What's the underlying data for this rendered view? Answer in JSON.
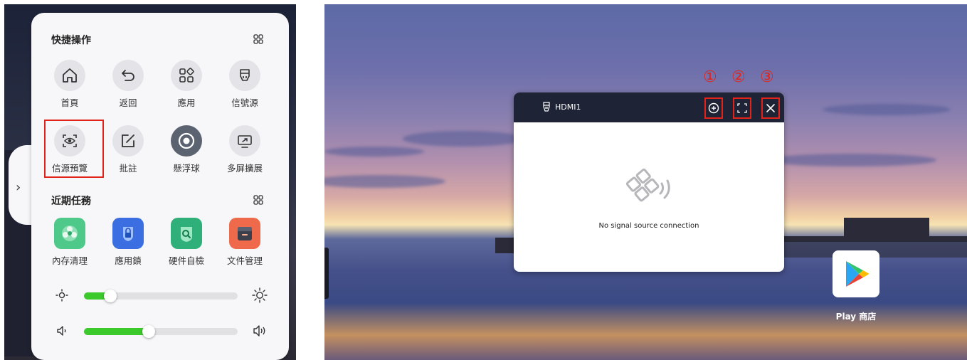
{
  "left_panel": {
    "quick_actions": {
      "title": "快捷操作",
      "items": [
        {
          "label": "首頁",
          "icon": "home-icon"
        },
        {
          "label": "返回",
          "icon": "back-icon"
        },
        {
          "label": "應用",
          "icon": "apps-icon"
        },
        {
          "label": "信號源",
          "icon": "signal-source-icon"
        },
        {
          "label": "信源預覽",
          "icon": "source-preview-icon"
        },
        {
          "label": "批註",
          "icon": "annotate-icon"
        },
        {
          "label": "懸浮球",
          "icon": "floating-ball-icon"
        },
        {
          "label": "多屏擴展",
          "icon": "multi-screen-icon"
        }
      ]
    },
    "recent_tasks": {
      "title": "近期任務",
      "items": [
        {
          "label": "內存清理",
          "icon": "memory-clean-icon",
          "color": "#4fc98a"
        },
        {
          "label": "應用鎖",
          "icon": "app-lock-icon",
          "color": "#3b6ee0"
        },
        {
          "label": "硬件自檢",
          "icon": "hardware-check-icon",
          "color": "#2fb07a"
        },
        {
          "label": "文件管理",
          "icon": "file-manager-icon",
          "color": "#ef6a4a"
        }
      ]
    },
    "brightness": {
      "level": 0.17
    },
    "volume": {
      "level": 0.42
    },
    "colors": {
      "accent": "#3cc92c",
      "highlight": "#e2231a"
    }
  },
  "right_panel": {
    "hdmi_window": {
      "title": "HDMI1",
      "message": "No signal source connection"
    },
    "annotations": [
      "①",
      "②",
      "③"
    ],
    "play_store": {
      "label": "Play 商店"
    }
  }
}
